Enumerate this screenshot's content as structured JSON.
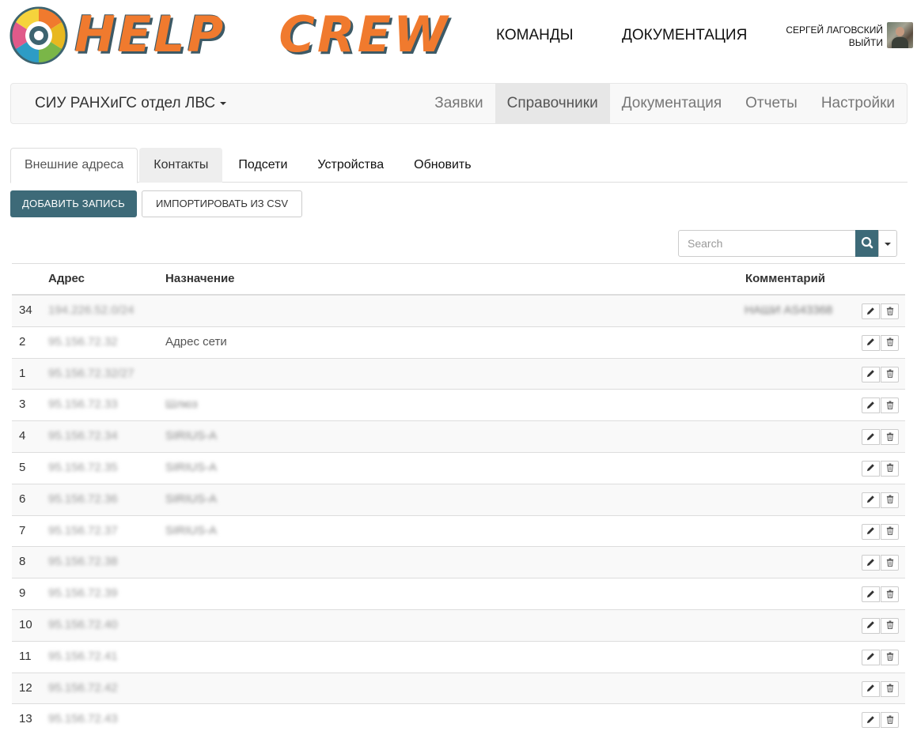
{
  "header": {
    "logo": {
      "word1": "HELP",
      "word2": "CREW"
    },
    "nav": [
      {
        "label": "КОМАНДЫ"
      },
      {
        "label": "ДОКУМЕНТАЦИЯ"
      }
    ],
    "user": {
      "name": "СЕРГЕЙ ЛАГОВСКИЙ",
      "logout": "ВЫЙТИ"
    }
  },
  "navbar": {
    "brand": "СИУ РАНХиГС отдел ЛВС",
    "items": [
      {
        "label": "Заявки",
        "active": false
      },
      {
        "label": "Справочники",
        "active": true
      },
      {
        "label": "Документация",
        "active": false
      },
      {
        "label": "Отчеты",
        "active": false
      },
      {
        "label": "Настройки",
        "active": false
      }
    ]
  },
  "tabs": [
    {
      "label": "Внешние адреса",
      "state": "active"
    },
    {
      "label": "Контакты",
      "state": "hover"
    },
    {
      "label": "Подсети",
      "state": ""
    },
    {
      "label": "Устройства",
      "state": ""
    },
    {
      "label": "Обновить",
      "state": ""
    }
  ],
  "toolbar": {
    "add_label": "ДОБАВИТЬ ЗАПИСЬ",
    "import_label": "ИМПОРТИРОВАТЬ ИЗ CSV"
  },
  "search": {
    "placeholder": "Search"
  },
  "table": {
    "columns": {
      "address": "Адрес",
      "purpose": "Назначение",
      "comment": "Комментарий"
    },
    "rows": [
      {
        "id": "34",
        "address": "194.226.52.0/24",
        "purpose": "",
        "purpose_blurred": false,
        "comment": "НАШИ AS43368"
      },
      {
        "id": "2",
        "address": "95.156.72.32",
        "purpose": "Адрес сети",
        "purpose_blurred": false,
        "comment": ""
      },
      {
        "id": "1",
        "address": "95.156.72.32/27",
        "purpose": "",
        "purpose_blurred": false,
        "comment": ""
      },
      {
        "id": "3",
        "address": "95.156.72.33",
        "purpose": "Шлюз",
        "purpose_blurred": true,
        "comment": ""
      },
      {
        "id": "4",
        "address": "95.156.72.34",
        "purpose": "SIRIUS-A",
        "purpose_blurred": true,
        "comment": ""
      },
      {
        "id": "5",
        "address": "95.156.72.35",
        "purpose": "SIRIUS-A",
        "purpose_blurred": true,
        "comment": ""
      },
      {
        "id": "6",
        "address": "95.156.72.36",
        "purpose": "SIRIUS-A",
        "purpose_blurred": true,
        "comment": ""
      },
      {
        "id": "7",
        "address": "95.156.72.37",
        "purpose": "SIRIUS-A",
        "purpose_blurred": true,
        "comment": ""
      },
      {
        "id": "8",
        "address": "95.156.72.38",
        "purpose": "",
        "purpose_blurred": false,
        "comment": ""
      },
      {
        "id": "9",
        "address": "95.156.72.39",
        "purpose": "",
        "purpose_blurred": false,
        "comment": ""
      },
      {
        "id": "10",
        "address": "95.156.72.40",
        "purpose": "",
        "purpose_blurred": false,
        "comment": ""
      },
      {
        "id": "11",
        "address": "95.156.72.41",
        "purpose": "",
        "purpose_blurred": false,
        "comment": ""
      },
      {
        "id": "12",
        "address": "95.156.72.42",
        "purpose": "",
        "purpose_blurred": false,
        "comment": ""
      },
      {
        "id": "13",
        "address": "95.156.72.43",
        "purpose": "",
        "purpose_blurred": false,
        "comment": ""
      }
    ]
  },
  "icons": {
    "edit": "pencil-icon",
    "delete": "trash-icon",
    "search": "search-icon"
  },
  "colors": {
    "primary": "#3d6a78",
    "logo_orange": "#f07a2e",
    "logo_teal": "#3d6470"
  }
}
